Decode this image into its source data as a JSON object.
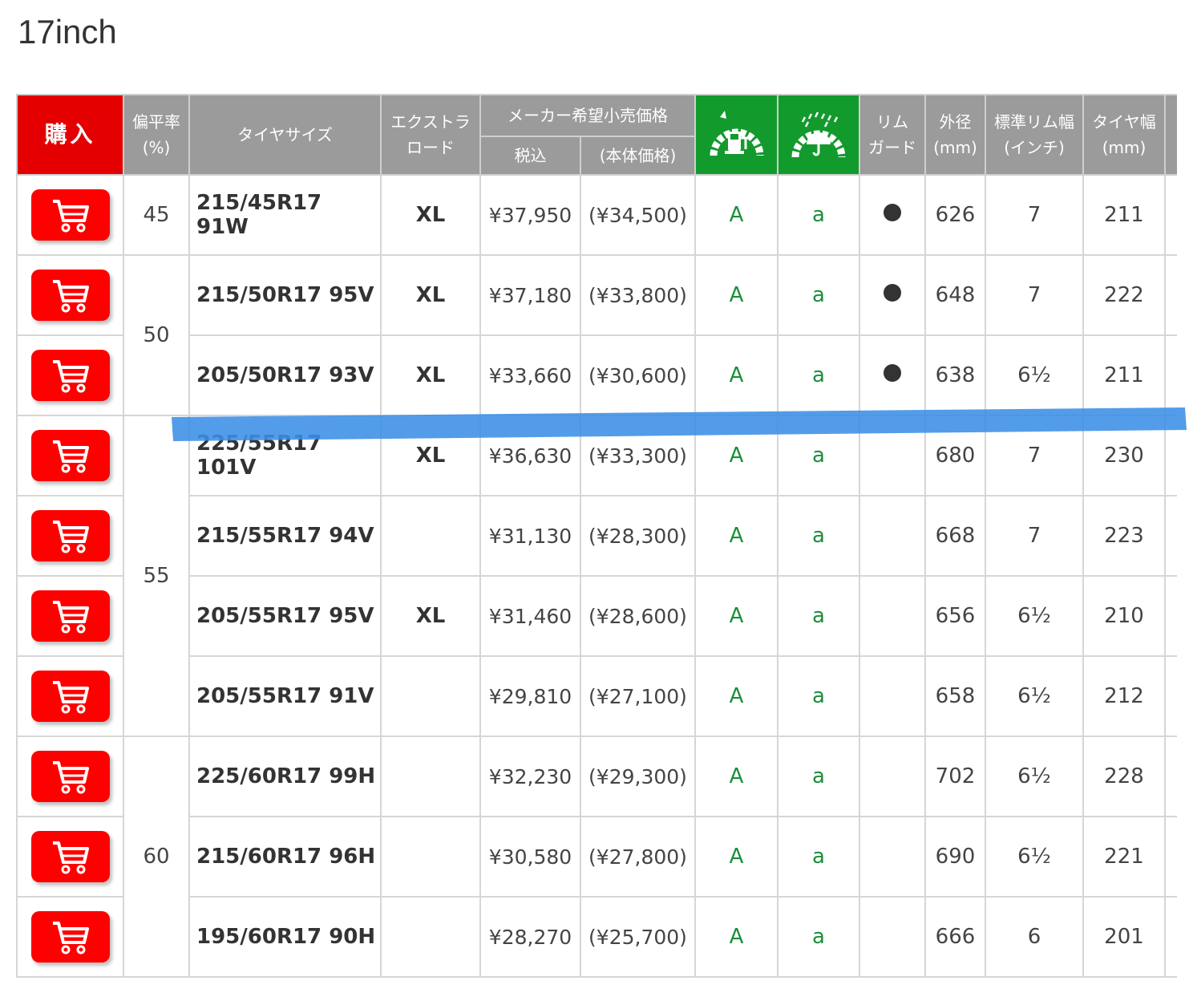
{
  "page": {
    "title": "17inch"
  },
  "header": {
    "buy": "購入",
    "aspect_line1": "偏平率",
    "aspect_line2": "(%)",
    "size": "タイヤサイズ",
    "extra_load_line1": "エクストラ",
    "extra_load_line2": "ロード",
    "price_group": "メーカー希望小売価格",
    "price_incl": "税込",
    "price_excl": "(本体価格)",
    "fuel_icon": "fuel-efficiency-tire-icon",
    "wet_icon": "wet-grip-tire-icon",
    "rim_line1": "リム",
    "rim_line2": "ガード",
    "diameter_line1": "外径",
    "diameter_line2": "(mm)",
    "rim_width_line1": "標準リム幅",
    "rim_width_line2": "(インチ)",
    "tire_width_line1": "タイヤ幅",
    "tire_width_line2": "(mm)"
  },
  "colors": {
    "buy_red": "#e40000",
    "cart_red": "#ff0000",
    "icon_green": "#139a2d",
    "grade_green": "#1a8f3a",
    "header_gray": "#9b9b9b",
    "highlight_blue": "#3b8ee6"
  },
  "rows": [
    {
      "aspect": "45",
      "size": "215/45R17 91W",
      "xl": "XL",
      "price": "¥37,950",
      "base_price": "(¥34,500)",
      "fuel": "A",
      "wet": "a",
      "rim_guard": true,
      "diameter": "626",
      "rim_width": "7",
      "width": "211"
    },
    {
      "aspect": "50",
      "size": "215/50R17 95V",
      "xl": "XL",
      "price": "¥37,180",
      "base_price": "(¥33,800)",
      "fuel": "A",
      "wet": "a",
      "rim_guard": true,
      "diameter": "648",
      "rim_width": "7",
      "width": "222"
    },
    {
      "aspect": "50",
      "size": "205/50R17 93V",
      "xl": "XL",
      "price": "¥33,660",
      "base_price": "(¥30,600)",
      "fuel": "A",
      "wet": "a",
      "rim_guard": true,
      "diameter": "638",
      "rim_width": "6½",
      "width": "211"
    },
    {
      "aspect": "55",
      "size": "225/55R17 101V",
      "xl": "XL",
      "price": "¥36,630",
      "base_price": "(¥33,300)",
      "fuel": "A",
      "wet": "a",
      "rim_guard": false,
      "diameter": "680",
      "rim_width": "7",
      "width": "230"
    },
    {
      "aspect": "55",
      "size": "215/55R17 94V",
      "xl": "",
      "price": "¥31,130",
      "base_price": "(¥28,300)",
      "fuel": "A",
      "wet": "a",
      "rim_guard": false,
      "diameter": "668",
      "rim_width": "7",
      "width": "223"
    },
    {
      "aspect": "55",
      "size": "205/55R17 95V",
      "xl": "XL",
      "price": "¥31,460",
      "base_price": "(¥28,600)",
      "fuel": "A",
      "wet": "a",
      "rim_guard": false,
      "diameter": "656",
      "rim_width": "6½",
      "width": "210"
    },
    {
      "aspect": "55",
      "size": "205/55R17 91V",
      "xl": "",
      "price": "¥29,810",
      "base_price": "(¥27,100)",
      "fuel": "A",
      "wet": "a",
      "rim_guard": false,
      "diameter": "658",
      "rim_width": "6½",
      "width": "212"
    },
    {
      "aspect": "60",
      "size": "225/60R17 99H",
      "xl": "",
      "price": "¥32,230",
      "base_price": "(¥29,300)",
      "fuel": "A",
      "wet": "a",
      "rim_guard": false,
      "diameter": "702",
      "rim_width": "6½",
      "width": "228"
    },
    {
      "aspect": "60",
      "size": "215/60R17 96H",
      "xl": "",
      "price": "¥30,580",
      "base_price": "(¥27,800)",
      "fuel": "A",
      "wet": "a",
      "rim_guard": false,
      "diameter": "690",
      "rim_width": "6½",
      "width": "221"
    },
    {
      "aspect": "60",
      "size": "195/60R17 90H",
      "xl": "",
      "price": "¥28,270",
      "base_price": "(¥25,700)",
      "fuel": "A",
      "wet": "a",
      "rim_guard": false,
      "diameter": "666",
      "rim_width": "6",
      "width": "201"
    }
  ]
}
